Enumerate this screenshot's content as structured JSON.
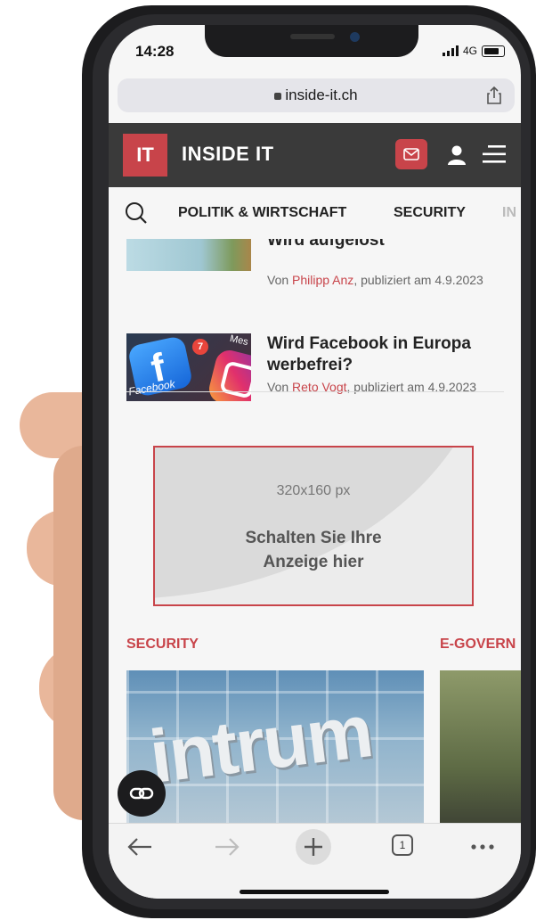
{
  "status": {
    "time": "14:28",
    "network": "4G"
  },
  "browser": {
    "url": "inside-it.ch"
  },
  "site": {
    "logo_mark": "IT",
    "logo_text": "INSIDE IT"
  },
  "nav": {
    "items": [
      "POLITIK & WIRTSCHAFT",
      "SECURITY",
      "IN"
    ]
  },
  "articles": [
    {
      "title": "Wird aufgelöst",
      "meta_prefix": "Von ",
      "author": "Philipp Anz",
      "meta_suffix": ", publiziert am 4.9.2023"
    },
    {
      "title": "Wird Facebook in Europa werbefrei?",
      "meta_prefix": "Von ",
      "author": "Reto Vogt",
      "meta_suffix": ", publiziert am 4.9.2023"
    }
  ],
  "thumb_labels": {
    "badge": "7",
    "facebook": "Facebook",
    "messenger": "Mes"
  },
  "ad": {
    "size": "320x160 px",
    "cta": "Schalten Sie Ihre Anzeige hier"
  },
  "sections": [
    "SECURITY",
    "E-GOVERN"
  ],
  "section_image_text": "intrum",
  "toolbar": {
    "tab_count": "1"
  }
}
